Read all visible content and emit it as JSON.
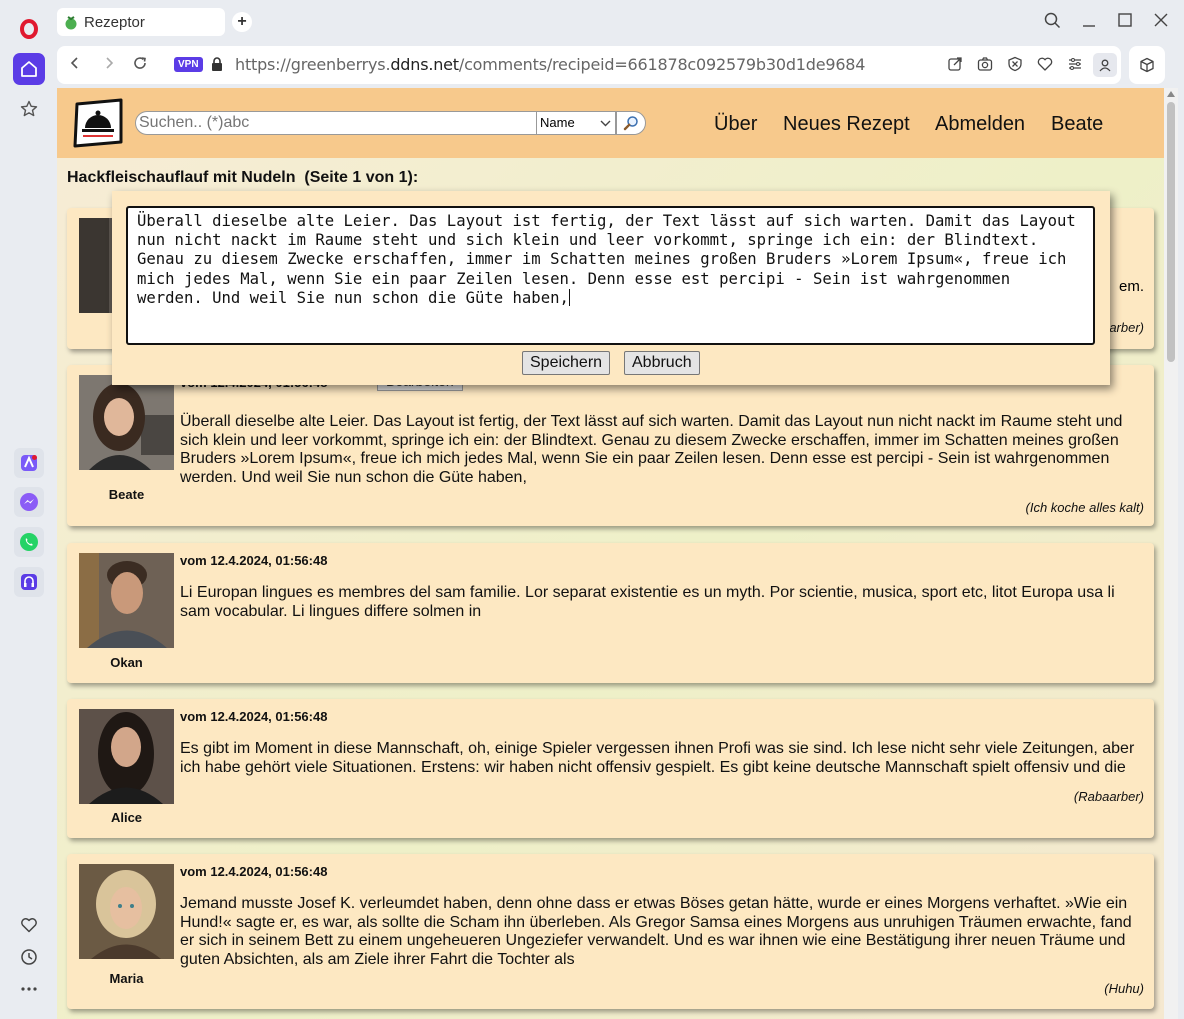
{
  "browser": {
    "tab_title": "Rezeptor",
    "new_tab": "+",
    "vpn_label": "VPN",
    "url_prefix": "https://greenberrys.",
    "url_domain": "ddns.net",
    "url_suffix": "/comments/recipeid=661878c092579b30d1de9684"
  },
  "header": {
    "search_placeholder": "Suchen.. (*)abc",
    "search_field_selected": "Name",
    "nav": [
      "Über",
      "Neues Rezept",
      "Abmelden",
      "Beate"
    ]
  },
  "page": {
    "title": "Hackfleischauflauf mit Nudeln  (Seite 1 von 1):"
  },
  "edit_dialog": {
    "text": "Überall dieselbe alte Leier. Das Layout ist fertig, der Text lässt auf sich warten. Damit das Layout nun nicht nackt im Raume steht und sich klein und leer vorkommt, springe ich ein: der Blindtext. Genau zu diesem Zwecke erschaffen, immer im Schatten meines großen Bruders »Lorem Ipsum«, freue ich mich jedes Mal, wenn Sie ein paar Zeilen lesen. Denn esse est percipi - Sein ist wahrgenommen werden. Und weil Sie nun schon die Güte haben,",
    "save_label": "Speichern",
    "cancel_label": "Abbruch"
  },
  "comments": [
    {
      "author": "",
      "date": "",
      "text_tail": "em.",
      "recipe": "arber)"
    },
    {
      "author": "Beate",
      "date": "vom 12.4.2024, 01:56:48",
      "edit_label": "Bearbeiten",
      "text": "Überall dieselbe alte Leier. Das Layout ist fertig, der Text lässt auf sich warten. Damit das Layout nun nicht nackt im Raume steht und sich klein und leer vorkommt, springe ich ein: der Blindtext. Genau zu diesem Zwecke erschaffen, immer im Schatten meines großen Bruders »Lorem Ipsum«, freue ich mich jedes Mal, wenn Sie ein paar Zeilen lesen. Denn esse est percipi - Sein ist wahrgenommen werden. Und weil Sie nun schon die Güte haben,",
      "recipe": "(Ich koche alles kalt)"
    },
    {
      "author": "Okan",
      "date": "vom 12.4.2024, 01:56:48",
      "text": "Li Europan lingues es membres del sam familie. Lor separat existentie es un myth. Por scientie, musica, sport etc, litot Europa usa li sam vocabular. Li lingues differe solmen in",
      "recipe": ""
    },
    {
      "author": "Alice",
      "date": "vom 12.4.2024, 01:56:48",
      "text": "Es gibt im Moment in diese Mannschaft, oh, einige Spieler vergessen ihnen Profi was sie sind. Ich lese nicht sehr viele Zeitungen, aber ich habe gehört viele Situationen. Erstens: wir haben nicht offensiv gespielt. Es gibt keine deutsche Mannschaft spielt offensiv und die",
      "recipe": "(Rabaarber)"
    },
    {
      "author": "Maria",
      "date": "vom 12.4.2024, 01:56:48",
      "text": "Jemand musste Josef K. verleumdet haben, denn ohne dass er etwas Böses getan hätte, wurde er eines Morgens verhaftet. »Wie ein Hund!« sagte er, es war, als sollte die Scham ihn überleben. Als Gregor Samsa eines Morgens aus unruhigen Träumen erwachte, fand er sich in seinem Bett zu einem ungeheueren Ungeziefer verwandelt. Und es war ihnen wie eine Bestätigung ihrer neuen Träume und guten Absichten, als am Ziele ihrer Fahrt die Tochter als",
      "recipe": "(Huhu)"
    }
  ],
  "colors": {
    "header_bg": "#f7c98c",
    "comment_bg": "#fde8c2",
    "opera_accent": "#5b3ce6"
  }
}
